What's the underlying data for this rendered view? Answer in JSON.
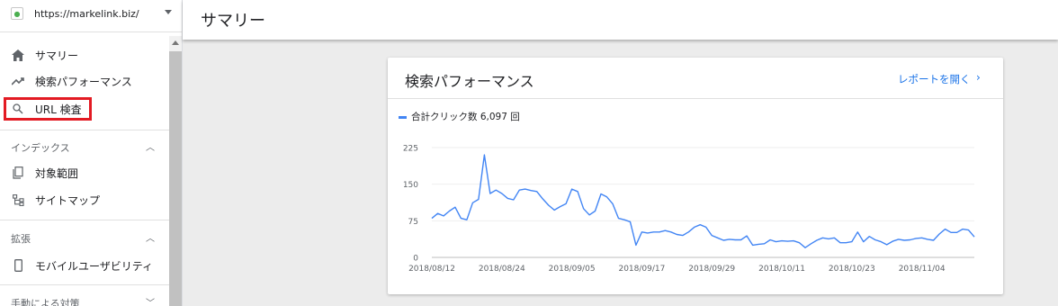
{
  "property": {
    "url": "https://markelink.biz/"
  },
  "sidebar": {
    "items": [
      {
        "label": "サマリー",
        "icon": "home-icon"
      },
      {
        "label": "検索パフォーマンス",
        "icon": "trending-up-icon"
      },
      {
        "label": "URL 検査",
        "icon": "search-icon"
      }
    ],
    "sections": [
      {
        "label": "インデックス",
        "items": [
          {
            "label": "対象範囲",
            "icon": "coverage-icon"
          },
          {
            "label": "サイトマップ",
            "icon": "sitemap-icon"
          }
        ]
      },
      {
        "label": "拡張",
        "items": [
          {
            "label": "モバイルユーザビリティ",
            "icon": "mobile-icon"
          }
        ]
      },
      {
        "label": "手動による対策",
        "items": []
      }
    ]
  },
  "header": {
    "title": "サマリー"
  },
  "card": {
    "title": "検索パフォーマンス",
    "open_report": "レポートを開く",
    "legend": "合計クリック数 6,097 回"
  },
  "colors": {
    "series": "#4285f4",
    "link": "#1a73e8",
    "highlight": "#e31b23"
  },
  "chart_data": {
    "type": "line",
    "yticks": [
      0,
      75,
      150,
      225
    ],
    "ylim": [
      0,
      225
    ],
    "xticks": [
      "2018/08/12",
      "2018/08/24",
      "2018/09/05",
      "2018/09/17",
      "2018/09/29",
      "2018/10/11",
      "2018/10/23",
      "2018/11/04"
    ],
    "series": [
      {
        "name": "合計クリック数",
        "values": [
          80,
          90,
          85,
          95,
          103,
          80,
          77,
          112,
          119,
          210,
          131,
          138,
          131,
          121,
          118,
          138,
          140,
          137,
          135,
          120,
          107,
          97,
          104,
          110,
          140,
          135,
          100,
          87,
          95,
          130,
          124,
          110,
          80,
          77,
          73,
          25,
          52,
          50,
          52,
          52,
          55,
          52,
          47,
          45,
          52,
          62,
          67,
          62,
          45,
          40,
          35,
          37,
          36,
          36,
          44,
          25,
          27,
          28,
          36,
          32,
          34,
          33,
          34,
          30,
          20,
          28,
          35,
          40,
          38,
          40,
          30,
          30,
          32,
          52,
          32,
          43,
          36,
          32,
          26,
          33,
          37,
          35,
          36,
          39,
          40,
          37,
          35,
          48,
          58,
          51,
          51,
          58,
          56,
          42
        ]
      }
    ]
  }
}
